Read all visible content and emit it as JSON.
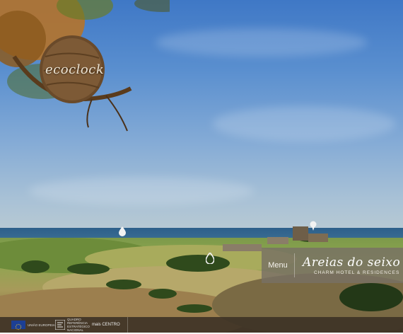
{
  "brand": {
    "ecoclock_label": "ecoclock",
    "hotel_name": "Areias do seixo",
    "hotel_tagline": "CHARM HOTEL & RESIDENCES"
  },
  "nav": {
    "menu_label": "Menu"
  },
  "footer": {
    "logos": [
      {
        "name": "eu-flag-logo",
        "text": "UNIÃO EUROPEIA"
      },
      {
        "name": "qren-logo",
        "text": "QUADRO\nREFERÊNCIA\nESTRATÉGICO\nNACIONAL"
      },
      {
        "name": "mais-centro-logo",
        "text": "mais CENTRO"
      }
    ]
  },
  "colors": {
    "sky_top": "#3f78c6",
    "panel": "#78705f",
    "footer": "#3a3024"
  }
}
